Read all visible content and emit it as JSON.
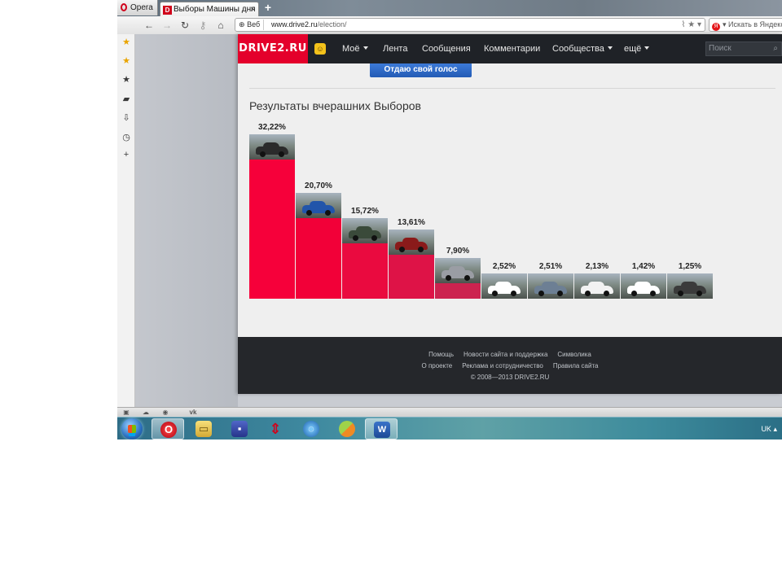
{
  "browser": {
    "menu_label": "Opera",
    "tab_title": "Выборы Машины дня",
    "tab_icon_letter": "D",
    "tab_close": "×",
    "new_tab": "+",
    "url_prefix": "Веб",
    "url_host": "www.drive2.ru",
    "url_path": "/election/",
    "search_placeholder": "Искать в Яндексе",
    "search_engine_letter": "Я"
  },
  "site": {
    "logo": "DRIVE2.RU",
    "nav": [
      {
        "label": "Моё",
        "dropdown": true
      },
      {
        "label": "Лента",
        "dropdown": false
      },
      {
        "label": "Сообщения",
        "dropdown": false
      },
      {
        "label": "Комментарии",
        "dropdown": false
      },
      {
        "label": "Сообщества",
        "dropdown": true
      },
      {
        "label": "ещё",
        "dropdown": true
      }
    ],
    "search_placeholder": "Поиск",
    "vote_button": "Отдаю свой голос",
    "results_title": "Результаты вчерашних Выборов"
  },
  "chart_data": {
    "type": "bar",
    "title": "Результаты вчерашних Выборов",
    "categories": [
      "",
      "",
      "",
      "",
      "",
      "",
      "",
      "",
      "",
      ""
    ],
    "values": [
      32.22,
      20.7,
      15.72,
      13.61,
      7.9,
      2.52,
      2.51,
      2.13,
      1.42,
      1.25
    ],
    "labels": [
      "32,22%",
      "20,70%",
      "15,72%",
      "13,61%",
      "7,90%",
      "2,52%",
      "2,51%",
      "2,13%",
      "1,42%",
      "1,25%"
    ],
    "ylim": [
      0,
      32.22
    ],
    "grid": false,
    "bar_colors": [
      "#f6003a",
      "#f20038",
      "#ea0a3f",
      "#de1347",
      "#cc234f",
      "#b43255",
      "#9e3958",
      "#86425c",
      "#6e4861",
      "#565a75"
    ],
    "photo_colors": [
      "#2b2b2b",
      "#2255aa",
      "#3a4a3a",
      "#8a1a1a",
      "#9a9da4",
      "#ffffff",
      "#6d7f94",
      "#f2f2f2",
      "#ffffff",
      "#3b3b3b"
    ]
  },
  "footer": {
    "links_row1": [
      "Помощь",
      "Новости сайта и поддержка",
      "Символика"
    ],
    "links_row2": [
      "О проекте",
      "Реклама и сотрудничество",
      "Правила сайта"
    ],
    "copyright": "© 2008—2013 DRIVE2.RU"
  },
  "taskbar": {
    "language": "UK"
  },
  "colors": {
    "brand_red": "#e4002b",
    "header_dark": "#1f2227",
    "vote_blue": "#2f6ccb"
  }
}
